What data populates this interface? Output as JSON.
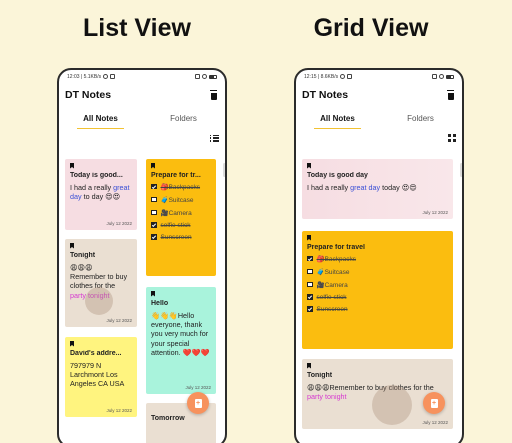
{
  "headings": {
    "list": "List View",
    "grid": "Grid View"
  },
  "app": {
    "title": "DT Notes"
  },
  "status_left": {
    "time": "12:03 | 5.1KB/s",
    "time_alt": "12:15 | 8.6KB/s"
  },
  "tabs": [
    {
      "label": "All Notes"
    },
    {
      "label": "Folders"
    }
  ],
  "colors": {
    "accent": "#f2c232",
    "fab": "#f7925d",
    "yellow_note": "#fbbd0f",
    "green_note": "#a9f3dc",
    "light_yellow_note": "#fff47f",
    "tan_note": "#eadfd2",
    "pink_note": "#f6dde2"
  },
  "icons": {
    "delete": "trash-icon",
    "list": "list-icon",
    "grid": "grid-icon",
    "add": "add-note-icon",
    "bookmark": "bookmark-icon"
  },
  "notes": {
    "today": {
      "title": "Today is good...",
      "title_full": "Today is good day",
      "body_pre": "I had a really ",
      "body_hl": "great day",
      "body_post": " to day 😍😍",
      "grid_body_pre": "I had a really ",
      "grid_body_hl": "great day",
      "grid_body_post": " today 😍😍",
      "date": "July 12 2022"
    },
    "travel": {
      "title": "Prepare for tr...",
      "title_full": "Prepare for travel",
      "items": [
        "🎒Backpacks",
        "🧳Suitcase",
        "🎥Camera",
        "selfie stick",
        "Sunscreen"
      ]
    },
    "tonight": {
      "title": "Tonight",
      "emoji": "😩😩😩",
      "body_pre": "Remember to buy clothes for the ",
      "body_hl": "party tonight",
      "date": "July 12 2022"
    },
    "hello": {
      "title": "Hello",
      "body": "👋👋👋Hello everyone, thank you very much for your special attention. ❤️❤️❤️",
      "date": "July 12 2022"
    },
    "address": {
      "title": "David's addre...",
      "body": "797979 N Larchmont Los Angeles CA USA",
      "date": "July 12 2022"
    },
    "tomorrow": {
      "title": "Tomorrow"
    }
  }
}
